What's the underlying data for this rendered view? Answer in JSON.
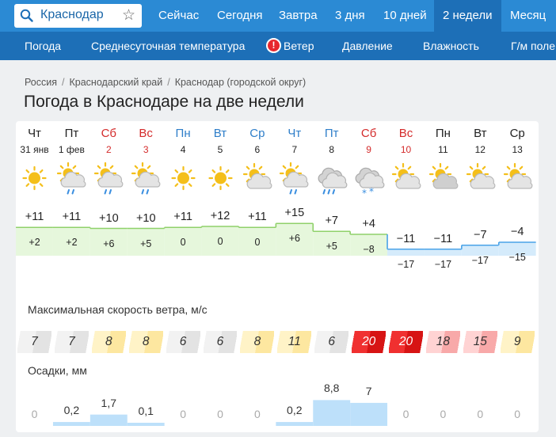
{
  "search": {
    "city": "Краснодар"
  },
  "top_nav": [
    "Сейчас",
    "Сегодня",
    "Завтра",
    "3 дня",
    "10 дней",
    "2 недели",
    "Месяц"
  ],
  "top_nav_active": "2 недели",
  "sub_nav": [
    "Погода",
    "Среднесуточная температура",
    "Ветер",
    "Давление",
    "Влажность",
    "Г/м поле"
  ],
  "sub_nav_warning_mark": "!",
  "breadcrumb": [
    "Россия",
    "Краснодарский край",
    "Краснодар (городской округ)"
  ],
  "page_title": "Погода в Краснодаре на две недели",
  "days": [
    {
      "name": "Чт",
      "date": "31 янв",
      "type": "weekday",
      "icon": "sun",
      "tmax": "+11",
      "tmin": "+2",
      "wind": "7",
      "precip": "0"
    },
    {
      "name": "Пт",
      "date": "1 фев",
      "type": "weekday",
      "icon": "sun-cloud-rain",
      "tmax": "+11",
      "tmin": "+2",
      "wind": "7",
      "precip": "0,2"
    },
    {
      "name": "Сб",
      "date": "2",
      "type": "weekend",
      "icon": "sun-cloud-rain",
      "tmax": "+10",
      "tmin": "+6",
      "wind": "8",
      "precip": "1,7"
    },
    {
      "name": "Вс",
      "date": "3",
      "type": "weekend",
      "icon": "sun-cloud-rain",
      "tmax": "+10",
      "tmin": "+5",
      "wind": "8",
      "precip": "0,1"
    },
    {
      "name": "Пн",
      "date": "4",
      "type": "weekday-blue",
      "icon": "sun",
      "tmax": "+11",
      "tmin": "0",
      "wind": "6",
      "precip": "0"
    },
    {
      "name": "Вт",
      "date": "5",
      "type": "weekday-blue",
      "icon": "sun",
      "tmax": "+12",
      "tmin": "0",
      "wind": "6",
      "precip": "0"
    },
    {
      "name": "Ср",
      "date": "6",
      "type": "weekday-blue",
      "icon": "sun-cloud",
      "tmax": "+11",
      "tmin": "0",
      "wind": "8",
      "precip": "0"
    },
    {
      "name": "Чт",
      "date": "7",
      "type": "weekday-blue",
      "icon": "sun-cloud-rain",
      "tmax": "+15",
      "tmin": "+6",
      "wind": "11",
      "precip": "0,2"
    },
    {
      "name": "Пт",
      "date": "8",
      "type": "weekday-blue",
      "icon": "cloud-rain",
      "tmax": "+7",
      "tmin": "+5",
      "wind": "6",
      "precip": "8,8"
    },
    {
      "name": "Сб",
      "date": "9",
      "type": "weekend",
      "icon": "cloud-snow",
      "tmax": "+4",
      "tmin": "−8",
      "wind": "20",
      "precip": "7"
    },
    {
      "name": "Вс",
      "date": "10",
      "type": "weekend",
      "icon": "sun-cloud",
      "tmax": "−11",
      "tmin": "−17",
      "wind": "20",
      "precip": "0"
    },
    {
      "name": "Пн",
      "date": "11",
      "type": "weekday",
      "icon": "sun-cloud-grey",
      "tmax": "−11",
      "tmin": "−17",
      "wind": "18",
      "precip": "0"
    },
    {
      "name": "Вт",
      "date": "12",
      "type": "weekday",
      "icon": "sun-cloud",
      "tmax": "−7",
      "tmin": "−17",
      "wind": "15",
      "precip": "0"
    },
    {
      "name": "Ср",
      "date": "13",
      "type": "weekday",
      "icon": "sun-cloud",
      "tmax": "−4",
      "tmin": "−15",
      "wind": "9",
      "precip": "0"
    }
  ],
  "temp_max_values": [
    11,
    11,
    10,
    10,
    11,
    12,
    11,
    15,
    7,
    4,
    -11,
    -11,
    -7,
    -4
  ],
  "temp_min_values": [
    2,
    2,
    6,
    5,
    0,
    0,
    0,
    6,
    5,
    -8,
    -17,
    -17,
    -17,
    -15
  ],
  "wind_section_label": "Максимальная скорость ветра, м/с",
  "wind_values": [
    7,
    7,
    8,
    8,
    6,
    6,
    8,
    11,
    6,
    20,
    20,
    18,
    15,
    9
  ],
  "precip_section_label": "Осадки, мм",
  "precip_values": [
    0,
    0.2,
    1.7,
    0.1,
    0,
    0,
    0,
    0.2,
    8.8,
    7,
    0,
    0,
    0,
    0
  ],
  "colors": {
    "nav_bg": "#2b8ad4",
    "nav_active": "#1d6fb7",
    "subnav_bg": "#1d6fb7",
    "warm_line": "#8fd16a",
    "warm_fill": "#e6f7dc",
    "cold_line": "#4aa3e8",
    "cold_fill": "#d5ebfb",
    "precip_bar": "#bde0fa",
    "sun": "#f4bf1a",
    "cloud": "#c9c9c9",
    "rain": "#3b8fe0"
  }
}
